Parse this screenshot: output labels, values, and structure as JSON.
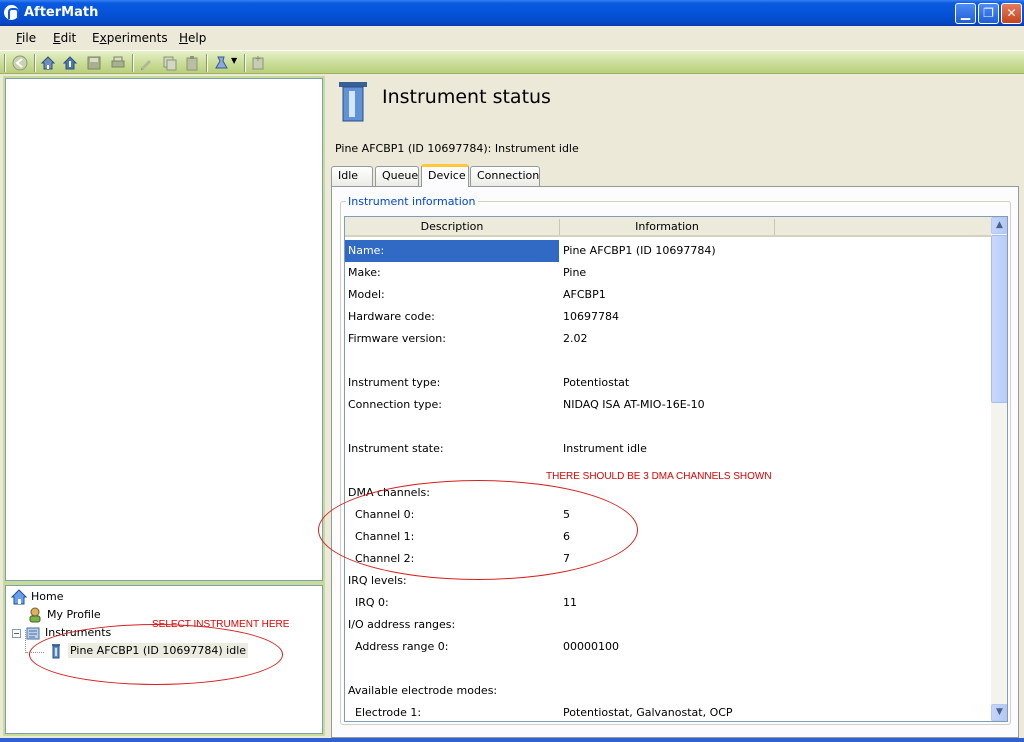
{
  "window": {
    "title": "AfterMath"
  },
  "menu": [
    {
      "label": "File",
      "accel": "F",
      "rest": "ile"
    },
    {
      "label": "Edit",
      "accel": "E",
      "rest": "dit"
    },
    {
      "label": "Experiments",
      "accel": "x",
      "pre": "E",
      "rest": "periments"
    },
    {
      "label": "Help",
      "accel": "H",
      "rest": "elp"
    }
  ],
  "toolbar": {
    "icons": [
      "back-icon",
      "home-icon",
      "home-up-icon",
      "save-icon",
      "print-icon",
      "edit-icon",
      "copy-icon",
      "paste-icon",
      "experiment-dropdown-icon",
      "new-instrument-icon"
    ]
  },
  "tree": {
    "home": "Home",
    "my_profile": "My Profile",
    "instruments": "Instruments",
    "instrument_item": "Pine AFCBP1 (ID 10697784) idle"
  },
  "annotations": {
    "select_note": "SELECT INSTRUMENT HERE",
    "dma_note": "THERE SHOULD BE 3 DMA CHANNELS SHOWN"
  },
  "main": {
    "title": "Instrument status",
    "status": "Pine AFCBP1 (ID 10697784): Instrument idle",
    "tabs": [
      "Idle",
      "Queue",
      "Device",
      "Connection"
    ],
    "active_tab": "Device",
    "group_title": "Instrument information",
    "columns": [
      "Description",
      "Information"
    ],
    "rows": [
      {
        "desc": "Name:",
        "info": "Pine AFCBP1 (ID 10697784)",
        "selected": true
      },
      {
        "desc": "Make:",
        "info": "Pine"
      },
      {
        "desc": "Model:",
        "info": "AFCBP1"
      },
      {
        "desc": "Hardware code:",
        "info": "10697784"
      },
      {
        "desc": "Firmware version:",
        "info": "2.02"
      },
      {
        "desc": "",
        "info": ""
      },
      {
        "desc": "Instrument type:",
        "info": "Potentiostat"
      },
      {
        "desc": "Connection type:",
        "info": "NIDAQ ISA AT-MIO-16E-10"
      },
      {
        "desc": "",
        "info": ""
      },
      {
        "desc": "Instrument state:",
        "info": "Instrument idle"
      },
      {
        "desc": "",
        "info": ""
      },
      {
        "desc": "DMA channels:",
        "info": ""
      },
      {
        "desc": "  Channel 0:",
        "info": "5"
      },
      {
        "desc": "  Channel 1:",
        "info": "6"
      },
      {
        "desc": "  Channel 2:",
        "info": "7"
      },
      {
        "desc": "IRQ levels:",
        "info": ""
      },
      {
        "desc": "  IRQ 0:",
        "info": "11"
      },
      {
        "desc": "I/O address ranges:",
        "info": ""
      },
      {
        "desc": "  Address range 0:",
        "info": "00000100"
      },
      {
        "desc": "",
        "info": ""
      },
      {
        "desc": "Available electrode modes:",
        "info": ""
      },
      {
        "desc": "  Electrode 1:",
        "info": "Potentiostat, Galvanostat, OCP"
      }
    ]
  }
}
